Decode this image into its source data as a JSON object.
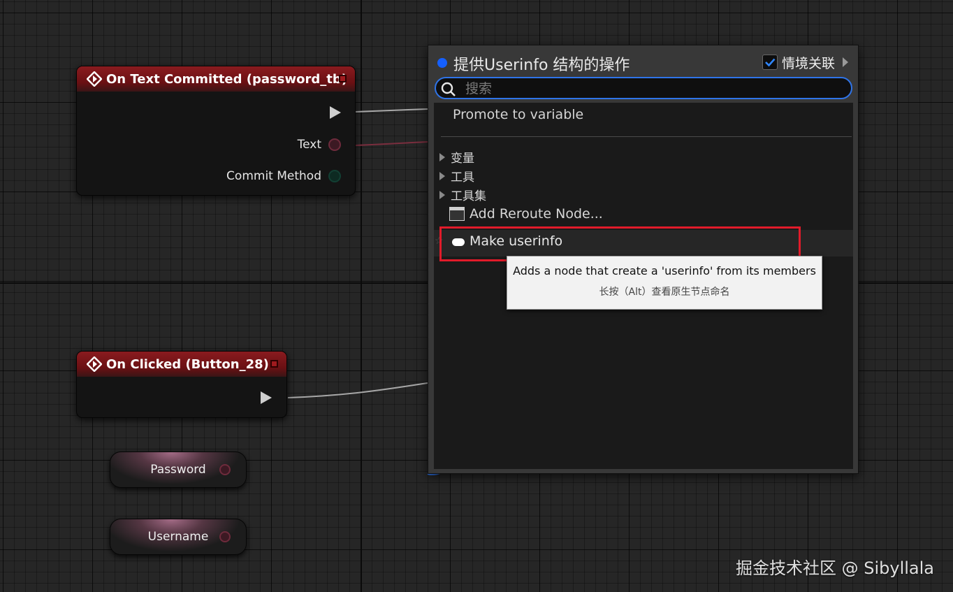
{
  "nodes": {
    "text_committed": {
      "title": "On Text Committed (password_tb)",
      "pins": {
        "text": "Text",
        "commit_method": "Commit Method"
      }
    },
    "on_clicked": {
      "title": "On Clicked (Button_28)"
    },
    "variables": {
      "password": "Password",
      "username": "Username"
    }
  },
  "action_menu": {
    "title": "提供Userinfo 结构的操作",
    "context_sensitive_label": "情境关联",
    "context_sensitive_checked": true,
    "search_placeholder": "搜索",
    "search_value": "",
    "promote": "Promote to variable",
    "categories": [
      "变量",
      "工具",
      "工具集"
    ],
    "reroute": "Add Reroute Node...",
    "make_item": "Make userinfo"
  },
  "tooltip": {
    "line1": "Adds a node that create a 'userinfo' from its members",
    "line2": "长按（Alt）查看原生节点命名"
  },
  "watermark": "掘金技术社区 @ Sibyllala",
  "colors": {
    "event_header": "#8a1b1f",
    "accent_blue": "#2f74e8",
    "highlight_red": "#e11b2a",
    "struct_pin": "#6e2b3c"
  }
}
